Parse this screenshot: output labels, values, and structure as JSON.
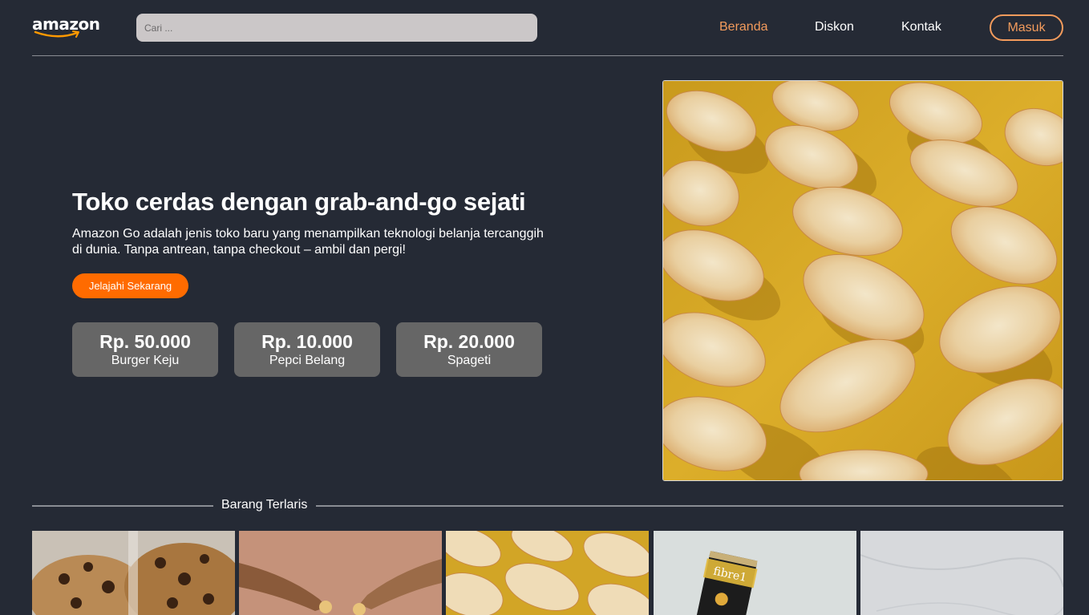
{
  "header": {
    "logo_text": "amazon",
    "search_placeholder": "Cari ...",
    "nav": [
      {
        "label": "Beranda",
        "active": true
      },
      {
        "label": "Diskon",
        "active": false
      },
      {
        "label": "Kontak",
        "active": false
      }
    ],
    "login_label": "Masuk"
  },
  "hero": {
    "title": "Toko cerdas dengan grab-and-go sejati",
    "description": "Amazon Go adalah jenis toko baru yang menampilkan teknologi belanja tercanggih di dunia. Tanpa antrean, tanpa checkout – ambil dan pergi!",
    "cta_label": "Jelajahi Sekarang",
    "products": [
      {
        "price": "Rp. 50.000",
        "name": "Burger Keju"
      },
      {
        "price": "Rp. 10.000",
        "name": "Pepci Belang"
      },
      {
        "price": "Rp. 20.000",
        "name": "Spageti"
      }
    ]
  },
  "bestsellers": {
    "title": "Barang Terlaris"
  },
  "colors": {
    "background": "#252a35",
    "accent": "#f39b5c",
    "cta": "#ff6b00",
    "card": "#666666"
  }
}
